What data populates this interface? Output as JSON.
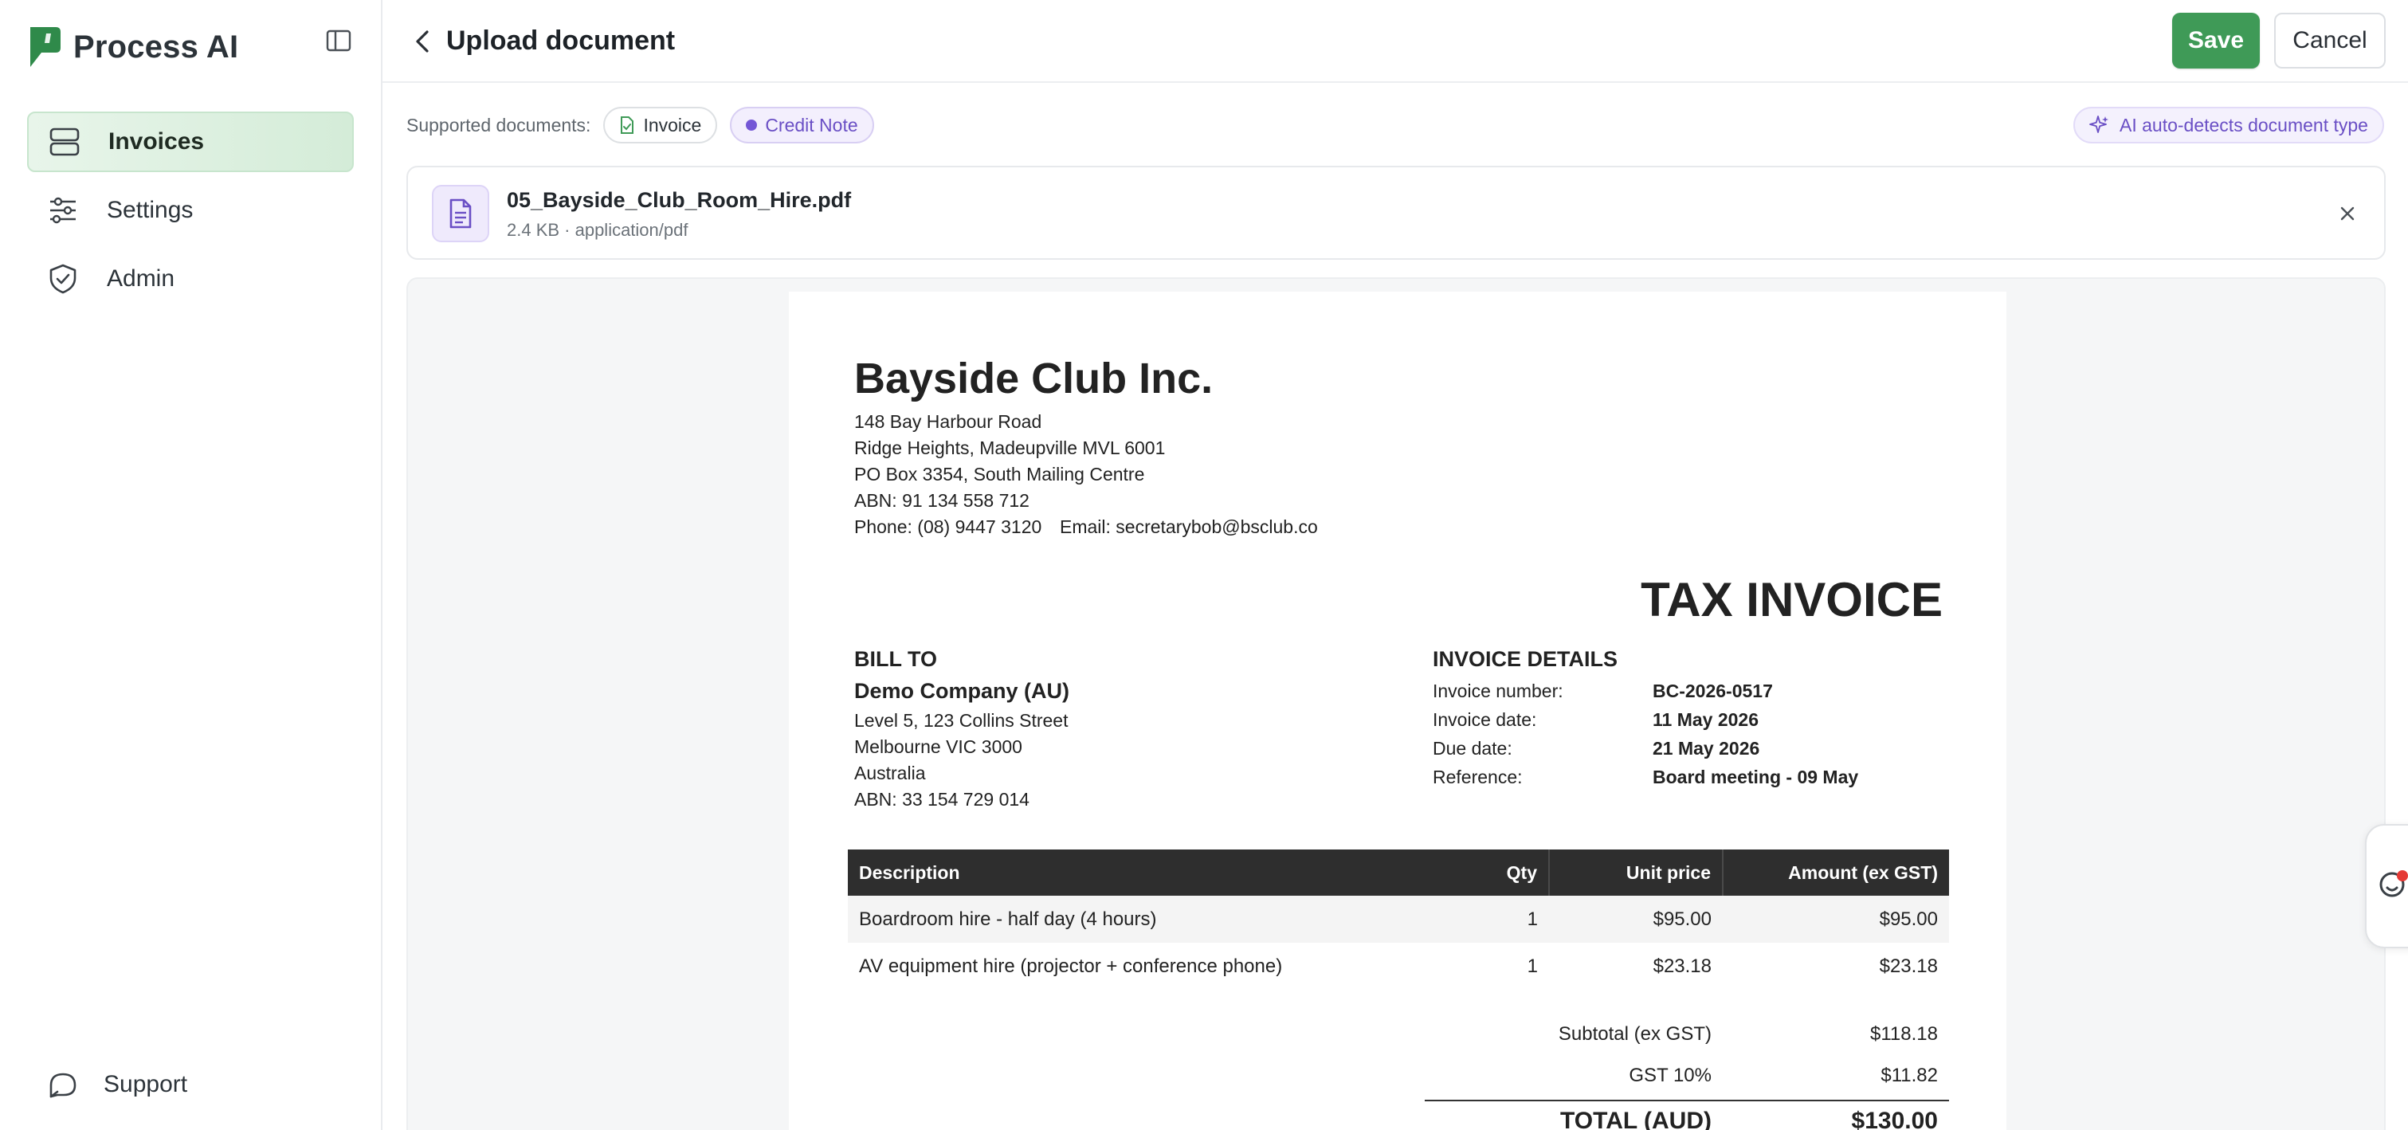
{
  "app": {
    "name": "Process AI"
  },
  "sidebar": {
    "items": [
      {
        "label": "Invoices",
        "icon": "invoices-icon",
        "active": true
      },
      {
        "label": "Settings",
        "icon": "sliders-icon",
        "active": false
      },
      {
        "label": "Admin",
        "icon": "shield-check-icon",
        "active": false
      }
    ],
    "support_label": "Support"
  },
  "header": {
    "title": "Upload document",
    "save_label": "Save",
    "cancel_label": "Cancel"
  },
  "supported": {
    "label": "Supported documents:",
    "types": [
      "Invoice",
      "Credit Note"
    ],
    "ai_hint": "AI auto-detects document type"
  },
  "file": {
    "name": "05_Bayside_Club_Room_Hire.pdf",
    "meta": "2.4 KB · application/pdf"
  },
  "invoice": {
    "company": "Bayside Club Inc.",
    "address_lines": [
      "148 Bay Harbour Road",
      "Ridge Heights, Madeupville MVL 6001",
      "PO Box 3354, South Mailing Centre",
      "ABN: 91 134 558 712"
    ],
    "phone": "Phone: (08) 9447 3120",
    "email": "Email: secretarybob@bsclub.co",
    "doc_title": "TAX INVOICE",
    "bill_to": {
      "heading": "BILL TO",
      "name": "Demo Company (AU)",
      "lines": [
        "Level 5, 123 Collins Street",
        "Melbourne VIC 3000",
        "Australia",
        "ABN: 33 154 729 014"
      ]
    },
    "details": {
      "heading": "INVOICE DETAILS",
      "rows": [
        {
          "label": "Invoice number:",
          "value": "BC-2026-0517"
        },
        {
          "label": "Invoice date:",
          "value": "11 May 2026"
        },
        {
          "label": "Due date:",
          "value": "21 May 2026"
        },
        {
          "label": "Reference:",
          "value": "Board meeting - 09 May"
        }
      ]
    },
    "table": {
      "headers": [
        "Description",
        "Qty",
        "Unit price",
        "Amount (ex GST)"
      ],
      "rows": [
        [
          "Boardroom hire - half day (4 hours)",
          "1",
          "$95.00",
          "$95.00"
        ],
        [
          "AV equipment hire (projector + conference phone)",
          "1",
          "$23.18",
          "$23.18"
        ]
      ]
    },
    "totals": {
      "subtotal_label": "Subtotal (ex GST)",
      "subtotal_value": "$118.18",
      "gst_label": "GST 10%",
      "gst_value": "$11.82",
      "total_label": "TOTAL (AUD)",
      "total_value": "$130.00"
    }
  },
  "colors": {
    "accent_green": "#3f9a57",
    "accent_purple": "#6a4fc5",
    "active_nav_bg": "#e1f2e4"
  }
}
